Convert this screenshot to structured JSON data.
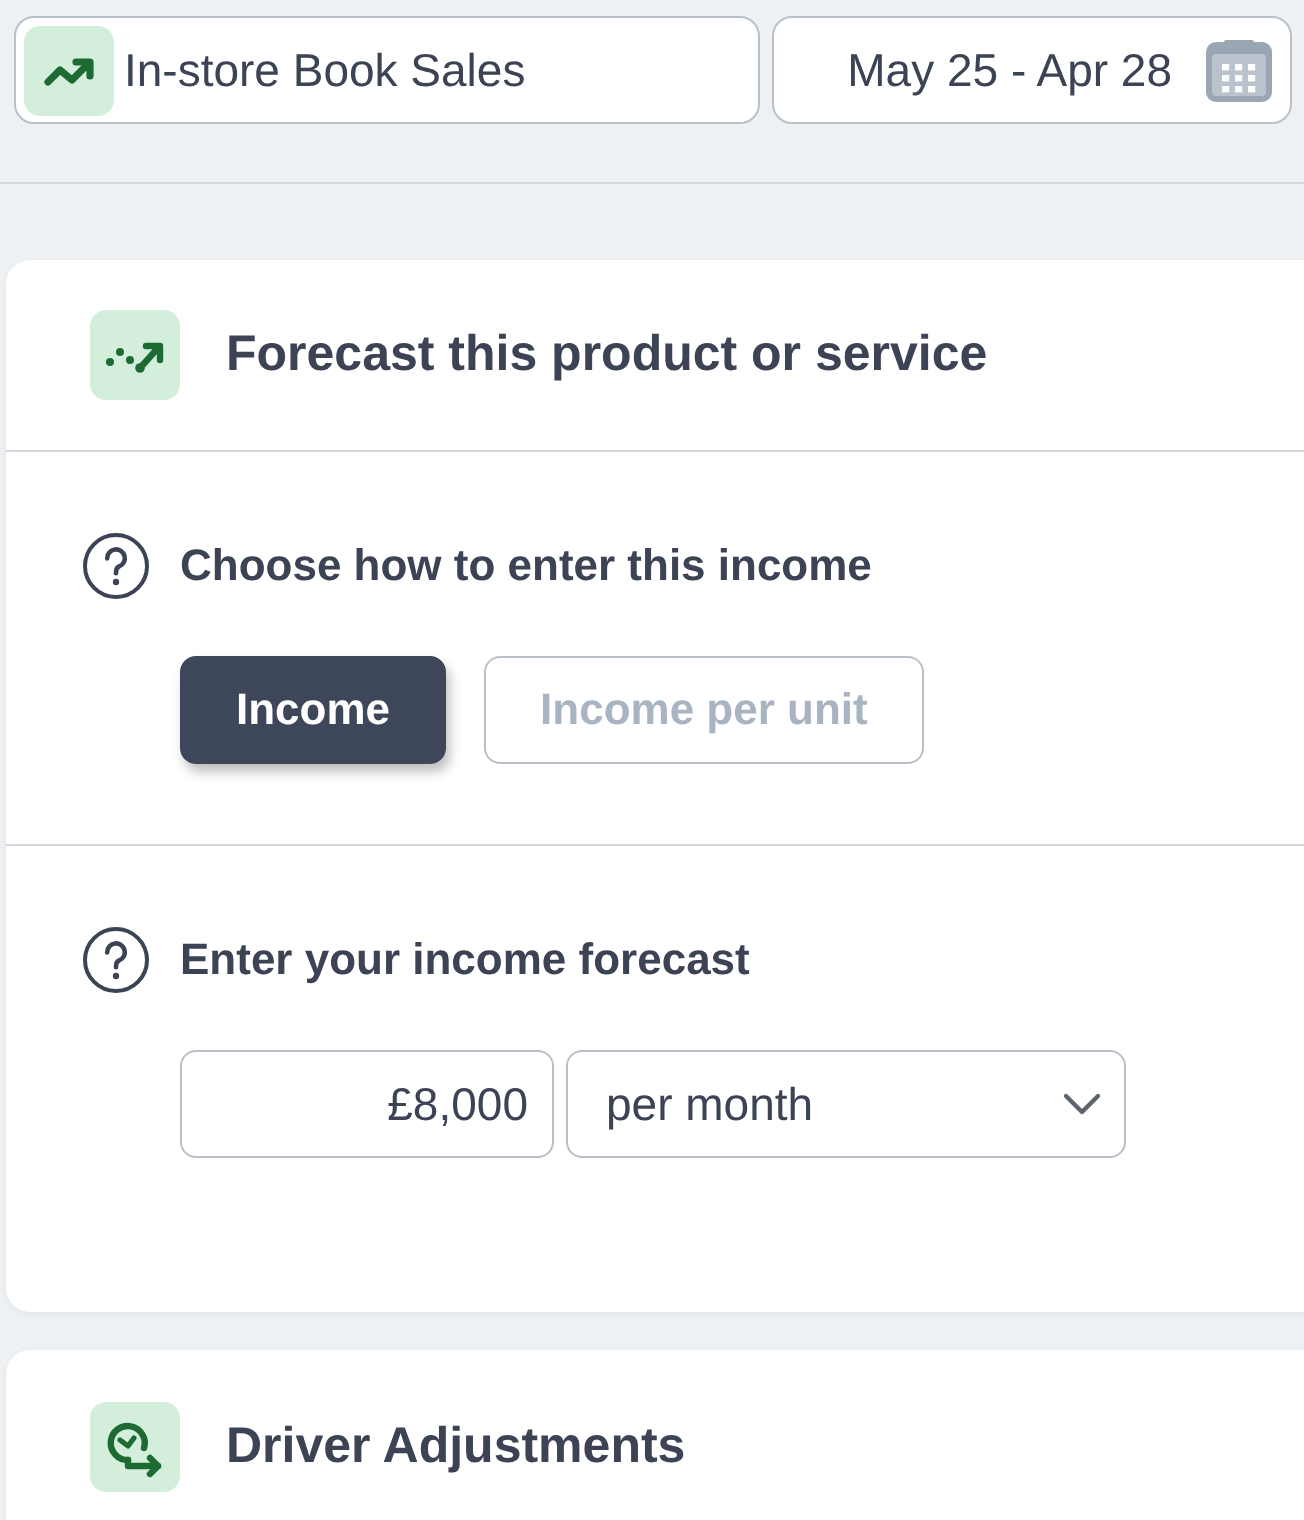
{
  "top_bar": {
    "product": {
      "label": "In-store Book Sales"
    },
    "date_range": {
      "label": "May 25 - Apr 28"
    }
  },
  "forecast_card": {
    "title": "Forecast this product or service",
    "sections": [
      {
        "kind": "toggle",
        "label": "Choose how to enter this income",
        "options": [
          {
            "label": "Income",
            "selected": true
          },
          {
            "label": "Income per unit",
            "selected": false
          }
        ]
      },
      {
        "kind": "amount",
        "label": "Enter your income forecast",
        "amount": {
          "value": "£8,000"
        },
        "period": {
          "value": "per month"
        }
      }
    ]
  },
  "driver_card": {
    "title": "Driver Adjustments"
  }
}
